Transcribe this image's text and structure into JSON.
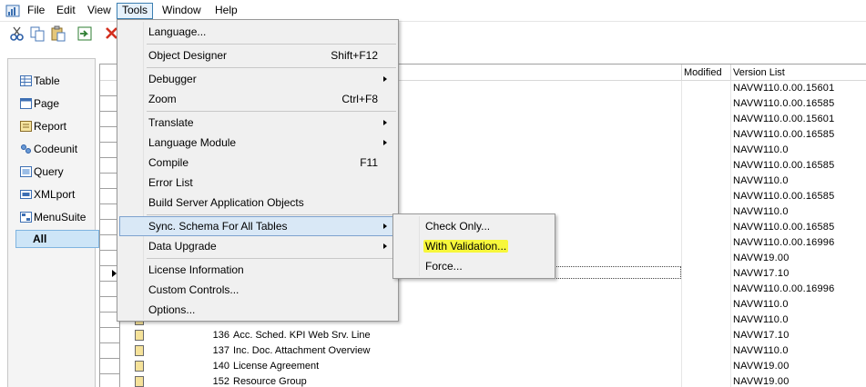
{
  "menubar": {
    "items": [
      {
        "label": "File"
      },
      {
        "label": "Edit"
      },
      {
        "label": "View"
      },
      {
        "label": "Tools"
      },
      {
        "label": "Window"
      },
      {
        "label": "Help"
      }
    ],
    "active": "Tools"
  },
  "toolbar": {
    "buttons": [
      "cut-icon",
      "copy-icon",
      "paste-icon",
      "import-icon",
      "delete-icon"
    ]
  },
  "nav": {
    "items": [
      {
        "label": "Table",
        "icon": "table-icon"
      },
      {
        "label": "Page",
        "icon": "page-icon"
      },
      {
        "label": "Report",
        "icon": "report-icon"
      },
      {
        "label": "Codeunit",
        "icon": "codeunit-icon"
      },
      {
        "label": "Query",
        "icon": "query-icon"
      },
      {
        "label": "XMLport",
        "icon": "xmlport-icon"
      },
      {
        "label": "MenuSuite",
        "icon": "menusuite-icon"
      },
      {
        "label": "All",
        "icon": ""
      }
    ],
    "selected": "All"
  },
  "grid": {
    "headers": {
      "modified": "Modified",
      "version": "Version List"
    },
    "versions": [
      "NAVW110.0.00.15601",
      "NAVW110.0.00.16585",
      "NAVW110.0.00.15601",
      "NAVW110.0.00.16585",
      "NAVW110.0",
      "NAVW110.0.00.16585",
      "NAVW110.0",
      "NAVW110.0.00.16585",
      "NAVW110.0",
      "NAVW110.0.00.16585",
      "NAVW110.0.00.16996",
      "NAVW19.00",
      "NAVW17.10",
      "NAVW110.0.00.16996",
      "NAVW110.0",
      "NAVW110.0",
      "NAVW17.10",
      "NAVW110.0",
      "NAVW19.00",
      "NAVW19.00"
    ],
    "visible_rows": [
      {
        "id": "136",
        "name": "Acc. Sched. KPI Web Srv. Line"
      },
      {
        "id": "137",
        "name": "Inc. Doc. Attachment Overview"
      },
      {
        "id": "140",
        "name": "License Agreement"
      },
      {
        "id": "152",
        "name": "Resource Group"
      }
    ]
  },
  "tools_menu": {
    "items": [
      {
        "label": "Language...",
        "shortcut": "",
        "submenu": false
      },
      {
        "label": "Object Designer",
        "shortcut": "Shift+F12",
        "submenu": false
      },
      {
        "label": "Debugger",
        "shortcut": "",
        "submenu": true
      },
      {
        "label": "Zoom",
        "shortcut": "Ctrl+F8",
        "submenu": false
      },
      {
        "label": "Translate",
        "shortcut": "",
        "submenu": true
      },
      {
        "label": "Language Module",
        "shortcut": "",
        "submenu": true
      },
      {
        "label": "Compile",
        "shortcut": "F11",
        "submenu": false
      },
      {
        "label": "Error List",
        "shortcut": "",
        "submenu": false
      },
      {
        "label": "Build Server Application Objects",
        "shortcut": "",
        "submenu": false
      },
      {
        "label": "Sync. Schema For All Tables",
        "shortcut": "",
        "submenu": true
      },
      {
        "label": "Data Upgrade",
        "shortcut": "",
        "submenu": true
      },
      {
        "label": "License Information",
        "shortcut": "",
        "submenu": false
      },
      {
        "label": "Custom Controls...",
        "shortcut": "",
        "submenu": false
      },
      {
        "label": "Options...",
        "shortcut": "",
        "submenu": false
      }
    ],
    "highlighted": "Sync. Schema For All Tables"
  },
  "sync_submenu": {
    "items": [
      {
        "label": "Check Only..."
      },
      {
        "label": "With Validation..."
      },
      {
        "label": "Force..."
      }
    ],
    "highlight_color": "#f7f73b"
  }
}
